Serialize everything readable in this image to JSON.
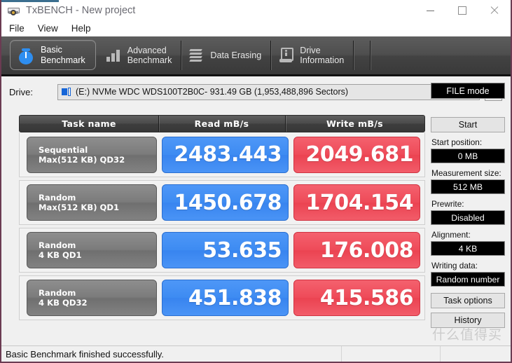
{
  "window": {
    "title": "TxBENCH - New project",
    "icon": "drive-icon",
    "minimize": "—",
    "maximize": "□",
    "close": "×"
  },
  "menu": {
    "items": [
      {
        "label": "File"
      },
      {
        "label": "View"
      },
      {
        "label": "Help"
      }
    ]
  },
  "tabs": [
    {
      "label": "Basic\nBenchmark",
      "icon": "stopwatch-icon",
      "active": true
    },
    {
      "label": "Advanced\nBenchmark",
      "icon": "bar-chart-icon",
      "active": false
    },
    {
      "label": "Data Erasing",
      "icon": "shredder-icon",
      "active": false
    },
    {
      "label": "Drive\nInformation",
      "icon": "drive-info-icon",
      "active": false
    }
  ],
  "drive": {
    "label": "Drive:",
    "selected": "(E:) NVMe WDC WDS100T2B0C-  931.49 GB (1,953,488,896 Sectors)",
    "icon": "disk-icon",
    "caret": "chevron-down-icon",
    "refresh": "refresh-icon"
  },
  "table": {
    "headers": [
      "Task name",
      "Read mB/s",
      "Write mB/s"
    ],
    "rows": [
      {
        "task_line1": "Sequential",
        "task_line2": "Max(512 KB) QD32",
        "read": "2483.443",
        "write": "2049.681"
      },
      {
        "task_line1": "Random",
        "task_line2": "Max(512 KB) QD1",
        "read": "1450.678",
        "write": "1704.154"
      },
      {
        "task_line1": "Random",
        "task_line2": "4 KB QD1",
        "read": "53.635",
        "write": "176.008"
      },
      {
        "task_line1": "Random",
        "task_line2": "4 KB QD32",
        "read": "451.838",
        "write": "415.586"
      }
    ]
  },
  "panel": {
    "mode_button": "FILE mode",
    "start_button": "Start",
    "start_position_label": "Start position:",
    "start_position_value": "0 MB",
    "measurement_size_label": "Measurement size:",
    "measurement_size_value": "512 MB",
    "prewrite_label": "Prewrite:",
    "prewrite_value": "Disabled",
    "alignment_label": "Alignment:",
    "alignment_value": "4 KB",
    "writing_data_label": "Writing data:",
    "writing_data_value": "Random number",
    "task_options_button": "Task options",
    "history_button": "History"
  },
  "status": {
    "message": "Basic Benchmark finished successfully."
  },
  "watermark": {
    "text": "什么值得买"
  },
  "colors": {
    "read_blue": "#3d8bf2",
    "write_red": "#ee4a58",
    "tab_dark": "#4a4a4a",
    "window_border": "#6b3b52",
    "title_accent": "#3b6e8f"
  }
}
